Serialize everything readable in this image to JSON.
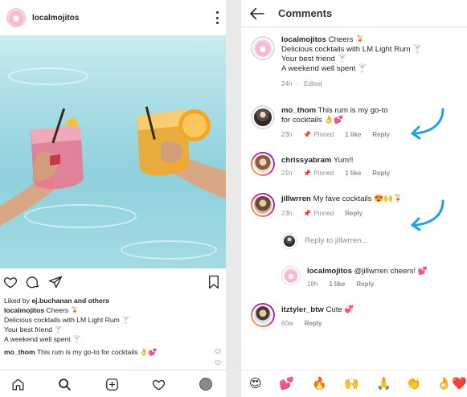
{
  "post": {
    "username": "localmojitos",
    "liked_by_prefix": "Liked by ",
    "liked_by_user": "ej.buchanan",
    "liked_by_suffix": " and others",
    "caption_user": "localmojitos",
    "caption_line1": " Cheers 🍹",
    "caption_line2": "Delicious cocktails with LM Light Rum 🍸",
    "caption_line3": "Your best friend 🍸",
    "caption_line4": "A weekend well spent 🍸",
    "comment_user": "mo_thom",
    "comment_text": " This rum is my go-to for cocktails 👌💕"
  },
  "comments_screen": {
    "title": "Comments",
    "caption": {
      "user": "localmojitos",
      "line1": " Cheers 🍹",
      "line2": "Delicious cocktails with LM Light Rum 🍸",
      "line3": "Your best friend 🍸",
      "line4": "A weekend well spent 🍸",
      "time": "24h",
      "edited": "Edited"
    },
    "comments": [
      {
        "user": "mo_thom",
        "text": " This rum is my go-to for cocktails 👌💕",
        "time": "23h",
        "pinned": "Pinned",
        "likes": "1 like",
        "reply": "Reply"
      },
      {
        "user": "chrissyabram",
        "text": " Yum!!",
        "time": "21h",
        "pinned": "Pinned",
        "likes": "1 like",
        "reply": "Reply"
      },
      {
        "user": "jillwrren",
        "text": " My fave cocktails 😍🙌🍹",
        "time": "23h",
        "pinned": "Pinned",
        "reply": "Reply"
      },
      {
        "user": "localmojitos",
        "text": " @jillwrren cheers! 💕",
        "time": "18h",
        "likes": "1 like",
        "reply": "Reply"
      },
      {
        "user": "itztyler_btw",
        "text": " Cute 💞",
        "time": "60w",
        "reply": "Reply"
      }
    ],
    "reply_placeholder": "Reply to jillwrren...",
    "emojis": [
      "😍",
      "💕",
      "🔥",
      "🙌",
      "🙏",
      "👏",
      "👌",
      "❤️"
    ]
  },
  "colors": {
    "accent_arrow": "#1aa3e8",
    "muted": "#8e8e8e",
    "heart": "#e0245e"
  }
}
